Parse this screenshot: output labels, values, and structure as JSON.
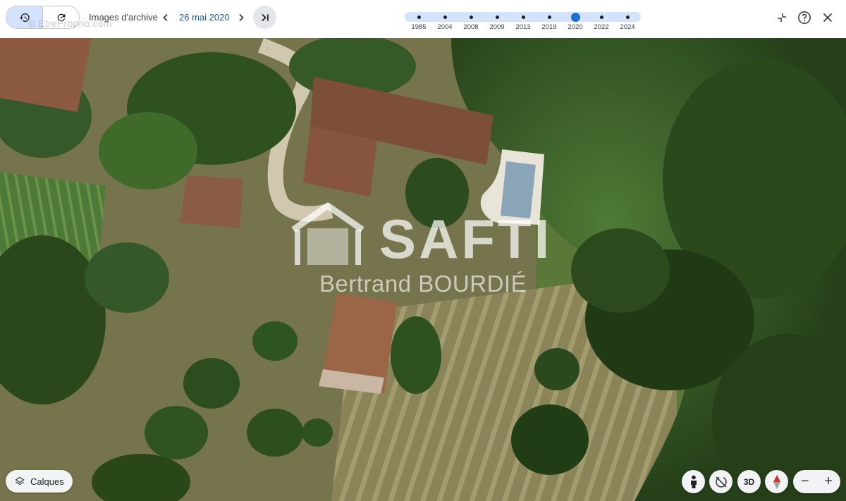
{
  "toolbar": {
    "watermark": "© EtreProprio.com",
    "archive_label": "Images d'archive",
    "current_date": "26 mai 2020",
    "history_icon": "history-icon",
    "refresh_icon": "refresh-icon"
  },
  "timeline": {
    "years": [
      "1985",
      "2004",
      "2008",
      "2009",
      "2013",
      "2019",
      "2020",
      "2022",
      "2024"
    ],
    "selected": "2020"
  },
  "overlay": {
    "brand": "SAFTI",
    "agent": "Bertrand BOURDIÉ"
  },
  "controls": {
    "layers_label": "Calques",
    "view_3d_label": "3D",
    "zoom_out": "−",
    "zoom_in": "+"
  },
  "colors": {
    "accent": "#1a6fd4",
    "timeline_track": "#d3e3fd",
    "date_text": "#1a56b8"
  }
}
